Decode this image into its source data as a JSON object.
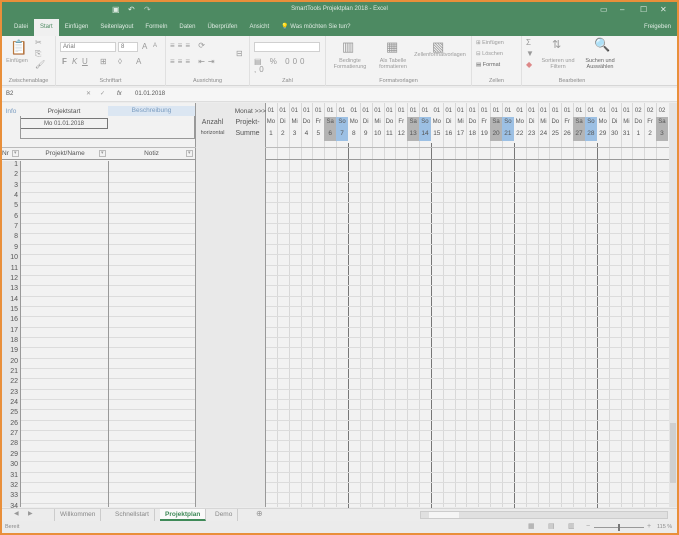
{
  "window": {
    "title": "SmartTools Projektplan 2018 - Excel",
    "share": "Freigeben"
  },
  "tabs": [
    "Datei",
    "Start",
    "Einfügen",
    "Seitenlayout",
    "Formeln",
    "Daten",
    "Überprüfen",
    "Ansicht"
  ],
  "active_tab": "Start",
  "tell_me": "Was möchten Sie tun?",
  "ribbon": {
    "clipboard": {
      "paste": "Einfügen",
      "label": "Zwischenablage"
    },
    "font": {
      "name": "Arial",
      "size": "8",
      "label": "Schriftart"
    },
    "alignment": {
      "label": "Ausrichtung"
    },
    "number": {
      "label": "Zahl"
    },
    "styles": {
      "conditional": "Bedingte Formatierung",
      "as_table": "Als Tabelle formatieren",
      "cell_styles": "Zellenformatvorlagen",
      "label": "Formatvorlagen"
    },
    "cells": {
      "insert": "Einfügen",
      "delete": "Löschen",
      "format": "Format",
      "label": "Zellen"
    },
    "editing": {
      "sort": "Sortieren und Filtern",
      "find": "Suchen und Auswählen",
      "label": "Bearbeiten"
    }
  },
  "formula_bar": {
    "name_box": "B2",
    "fx": "fx",
    "value": "01.01.2018"
  },
  "sheet": {
    "info": "Info",
    "projektstart": "Projektstart",
    "beschreibung": "Beschreibung",
    "start_value": "Mo 01.01.2018",
    "anzahl": "Anzahl",
    "horizontal": "horizontal",
    "projekt": "Projekt-",
    "summe": "Summe",
    "monat": "Monat >>>",
    "nr": "Nr",
    "projekt_name": "Projekt/Name",
    "notiz": "Notiz",
    "days": [
      {
        "m": "01",
        "d": "Mo",
        "n": "1"
      },
      {
        "m": "01",
        "d": "Di",
        "n": "2"
      },
      {
        "m": "01",
        "d": "Mi",
        "n": "3"
      },
      {
        "m": "01",
        "d": "Do",
        "n": "4"
      },
      {
        "m": "01",
        "d": "Fr",
        "n": "5"
      },
      {
        "m": "01",
        "d": "Sa",
        "n": "6"
      },
      {
        "m": "01",
        "d": "So",
        "n": "7"
      },
      {
        "m": "01",
        "d": "Mo",
        "n": "8"
      },
      {
        "m": "01",
        "d": "Di",
        "n": "9"
      },
      {
        "m": "01",
        "d": "Mi",
        "n": "10"
      },
      {
        "m": "01",
        "d": "Do",
        "n": "11"
      },
      {
        "m": "01",
        "d": "Fr",
        "n": "12"
      },
      {
        "m": "01",
        "d": "Sa",
        "n": "13"
      },
      {
        "m": "01",
        "d": "So",
        "n": "14"
      },
      {
        "m": "01",
        "d": "Mo",
        "n": "15"
      },
      {
        "m": "01",
        "d": "Di",
        "n": "16"
      },
      {
        "m": "01",
        "d": "Mi",
        "n": "17"
      },
      {
        "m": "01",
        "d": "Do",
        "n": "18"
      },
      {
        "m": "01",
        "d": "Fr",
        "n": "19"
      },
      {
        "m": "01",
        "d": "Sa",
        "n": "20"
      },
      {
        "m": "01",
        "d": "So",
        "n": "21"
      },
      {
        "m": "01",
        "d": "Mo",
        "n": "22"
      },
      {
        "m": "01",
        "d": "Di",
        "n": "23"
      },
      {
        "m": "01",
        "d": "Mi",
        "n": "24"
      },
      {
        "m": "01",
        "d": "Do",
        "n": "25"
      },
      {
        "m": "01",
        "d": "Fr",
        "n": "26"
      },
      {
        "m": "01",
        "d": "Sa",
        "n": "27"
      },
      {
        "m": "01",
        "d": "So",
        "n": "28"
      },
      {
        "m": "01",
        "d": "Mo",
        "n": "29"
      },
      {
        "m": "01",
        "d": "Di",
        "n": "30"
      },
      {
        "m": "01",
        "d": "Mi",
        "n": "31"
      },
      {
        "m": "02",
        "d": "Do",
        "n": "1"
      },
      {
        "m": "02",
        "d": "Fr",
        "n": "2"
      },
      {
        "m": "02",
        "d": "Sa",
        "n": "3"
      }
    ],
    "rows": [
      "1",
      "2",
      "3",
      "4",
      "5",
      "6",
      "7",
      "8",
      "9",
      "10",
      "11",
      "12",
      "13",
      "14",
      "15",
      "16",
      "17",
      "18",
      "19",
      "20",
      "21",
      "22",
      "23",
      "24",
      "25",
      "26",
      "27",
      "28",
      "29",
      "30",
      "31",
      "32",
      "33",
      "34"
    ]
  },
  "sheet_tabs": [
    "Willkommen",
    "Schnellstart",
    "Projektplan",
    "Demo"
  ],
  "active_sheet": "Projektplan",
  "status": {
    "ready": "Bereit",
    "zoom": "115 %"
  },
  "colors": {
    "excel_green": "#4d8a62",
    "saturday": "#b4b4b4",
    "sunday": "#9cc0e4",
    "frame": "#e98f3a"
  }
}
